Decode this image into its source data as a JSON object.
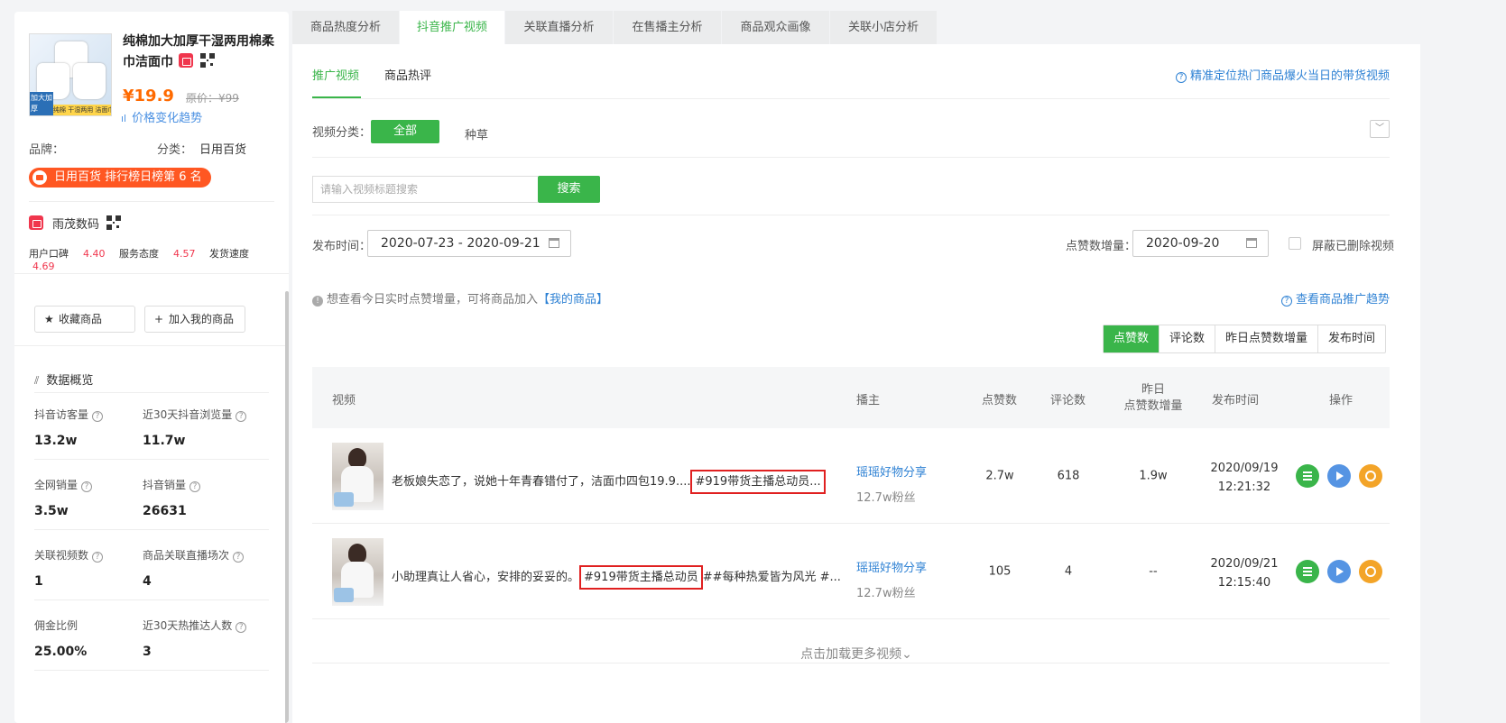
{
  "product": {
    "image_tag": "加大加厚",
    "image_strip": "纯棉 干湿两用 洁面巾",
    "title": "纯棉加大加厚干湿两用棉柔巾洁面巾",
    "price": "¥19.9",
    "original_price": "原价：¥99",
    "price_trend": "价格变化趋势",
    "brand_label": "品牌：",
    "category_label": "分类：",
    "category_value": "日用百货",
    "rank_badge": "日用百货 排行榜日榜第 6 名"
  },
  "shop": {
    "name": "雨茂数码",
    "scores": [
      {
        "label": "用户口碑",
        "value": "4.40"
      },
      {
        "label": "服务态度",
        "value": "4.57"
      },
      {
        "label": "发货速度",
        "value": "4.69"
      }
    ]
  },
  "actions": {
    "favorite": "收藏商品",
    "add_mine": "加入我的商品"
  },
  "overview": {
    "title": "数据概览",
    "stats": [
      {
        "label": "抖音访客量",
        "value": "13.2w"
      },
      {
        "label": "近30天抖音浏览量",
        "value": "11.7w"
      },
      {
        "label": "全网销量",
        "value": "3.5w"
      },
      {
        "label": "抖音销量",
        "value": "26631"
      },
      {
        "label": "关联视频数",
        "value": "1"
      },
      {
        "label": "商品关联直播场次",
        "value": "4"
      },
      {
        "label": "佣金比例",
        "value": "25.00%"
      },
      {
        "label": "近30天热推达人数",
        "value": "3"
      }
    ]
  },
  "tabs": [
    "商品热度分析",
    "抖音推广视频",
    "关联直播分析",
    "在售播主分析",
    "商品观众画像",
    "关联小店分析"
  ],
  "subtabs": [
    "推广视频",
    "商品热评"
  ],
  "help_link": "精准定位热门商品爆火当日的带货视频",
  "filter": {
    "category_label": "视频分类：",
    "options": [
      "全部",
      "种草"
    ],
    "search_placeholder": "请输入视频标题搜索",
    "search_button": "搜索",
    "publish_label": "发布时间：",
    "publish_range": "2020-07-23 - 2020-09-21",
    "likes_inc_label": "点赞数增量：",
    "likes_inc_date": "2020-09-20",
    "hide_deleted": "屏蔽已删除视频"
  },
  "info": {
    "text": "想查看今日实时点赞增量，可将商品加入",
    "link": "【我的商品】",
    "trend_link": "查看商品推广趋势"
  },
  "sort": [
    "点赞数",
    "评论数",
    "昨日点赞数增量",
    "发布时间"
  ],
  "table": {
    "headers": {
      "video": "视频",
      "anchor": "播主",
      "likes": "点赞数",
      "comments": "评论数",
      "inc_line1": "昨日",
      "inc_line2": "点赞数增量",
      "time": "发布时间",
      "ops": "操作"
    },
    "rows": [
      {
        "title_pre": "老板娘失恋了，说她十年青春错付了，洁面巾四包19.9....",
        "title_hl": "#919带货主播总动员...",
        "title_post": "",
        "anchor": "瑶瑶好物分享",
        "fans": "12.7w粉丝",
        "likes": "2.7w",
        "comments": "618",
        "inc": "1.9w",
        "date": "2020/09/19",
        "time": "12:21:32"
      },
      {
        "title_pre": "小助理真让人省心，安排的妥妥的。",
        "title_hl": "#919带货主播总动员",
        "title_post": "##每种热爱皆为风光 #...",
        "anchor": "瑶瑶好物分享",
        "fans": "12.7w粉丝",
        "likes": "105",
        "comments": "4",
        "inc": "--",
        "date": "2020/09/21",
        "time": "12:15:40"
      }
    ]
  },
  "load_more": "点击加载更多视频",
  "colors": {
    "accent": "#3ab54a",
    "link": "#2f82d4",
    "price": "#ff6a00",
    "rank": "#ff5722",
    "highlight": "#e02020"
  }
}
